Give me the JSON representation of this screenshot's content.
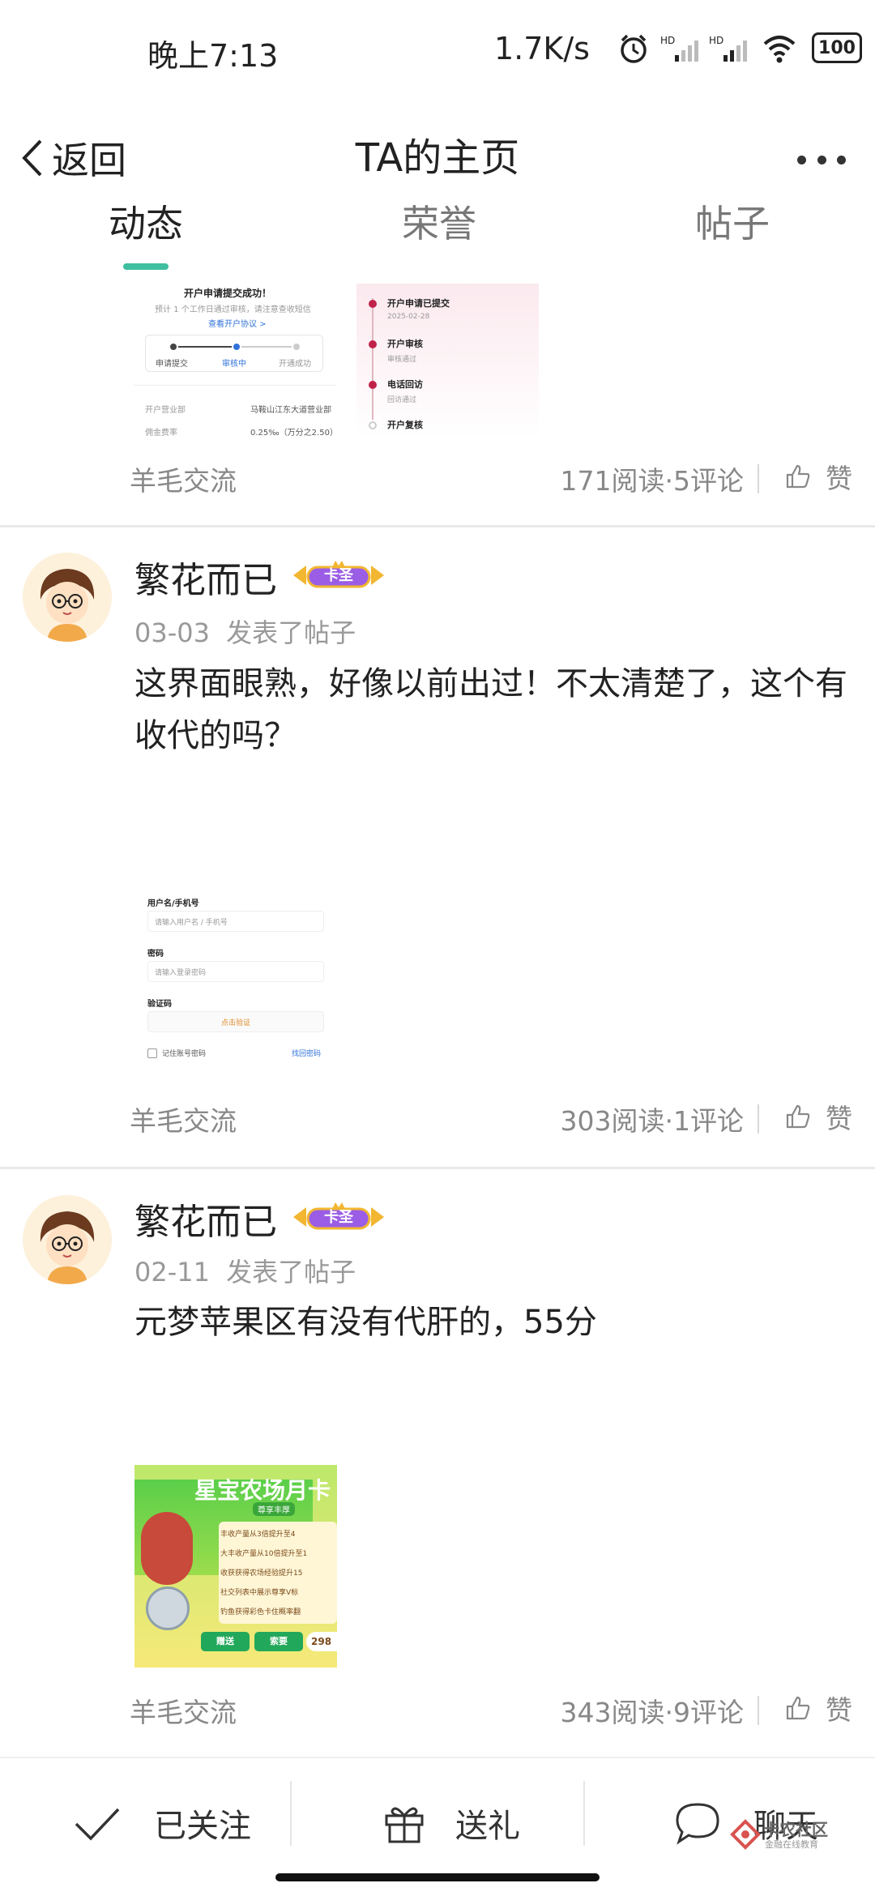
{
  "status": {
    "time": "晚上7:13",
    "speed": "1.7K/s",
    "battery": "100"
  },
  "nav": {
    "back_label": "返回",
    "title": "TA的主页"
  },
  "tabs": [
    {
      "label": "动态",
      "active": true
    },
    {
      "label": "荣誉",
      "active": false
    },
    {
      "label": "帖子",
      "active": false
    }
  ],
  "post1": {
    "thumb_left": {
      "title": "开户申请提交成功！",
      "subtitle": "预计 1 个工作日通过审核，请注意查收短信",
      "link": "查看开户协议 >",
      "steps": [
        "申请提交",
        "审核中",
        "开通成功"
      ],
      "row1_label": "开户营业部",
      "row1_value": "马鞍山江东大道营业部",
      "row2_label": "佣金费率",
      "row2_value": "0.25‰（万分之2.50）"
    },
    "thumb_right": {
      "items": [
        {
          "title": "开户申请已提交",
          "sub": "2025-02-28"
        },
        {
          "title": "开户审核",
          "sub": "审核通过"
        },
        {
          "title": "电话回访",
          "sub": "回访通过"
        },
        {
          "title": "开户复核",
          "sub": ""
        }
      ]
    },
    "category": "羊毛交流",
    "stats": "171阅读·5评论",
    "like": "赞"
  },
  "post2": {
    "author": "繁花而已",
    "badge": "卡圣",
    "date": "03-03",
    "action": "发表了帖子",
    "text": "这界面眼熟，好像以前出过！不太清楚了，这个有收代的吗？",
    "form": {
      "user_label": "用户名/手机号",
      "user_placeholder": "请输入用户名 / 手机号",
      "pwd_label": "密码",
      "pwd_placeholder": "请输入登录密码",
      "code_label": "验证码",
      "code_button": "点击验证",
      "remember": "记住账号密码",
      "forgot": "找回密码"
    },
    "category": "羊毛交流",
    "stats": "303阅读·1评论",
    "like": "赞"
  },
  "post3": {
    "author": "繁花而已",
    "badge": "卡圣",
    "date": "02-11",
    "action": "发表了帖子",
    "text": "元梦苹果区有没有代肝的，55分",
    "game": {
      "banner": "星宝农场月卡",
      "sub": "尊享丰厚",
      "rows": [
        "丰收产量从3倍提升至4",
        "大丰收产量从10倍提升至1",
        "收获获得农场经验提升15",
        "社交列表中展示尊享V标",
        "钓鱼获得彩色卡住概率翻"
      ],
      "btn1": "赠送",
      "btn2": "索要",
      "price": "298"
    },
    "category": "羊毛交流",
    "stats": "343阅读·9评论",
    "like": "赞"
  },
  "bottom": {
    "follow": "已关注",
    "gift": "送礼",
    "chat": "聊天"
  },
  "watermark": {
    "name": "卡农社区",
    "sub": "金融在线教育"
  },
  "colors": {
    "accent": "#3fbf9f",
    "muted": "#888888",
    "badge_purple": "#9b5de5",
    "badge_gold": "#f2b631"
  }
}
